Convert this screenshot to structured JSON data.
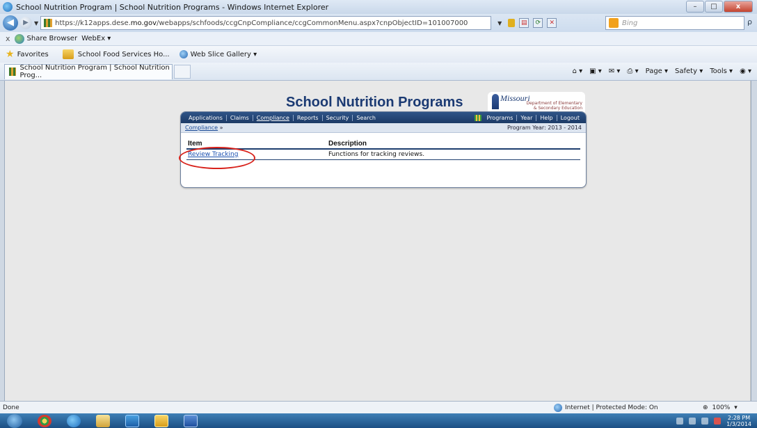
{
  "window": {
    "title": "School Nutrition Program | School Nutrition Programs - Windows Internet Explorer",
    "minimize_glyph": "–",
    "maximize_glyph": "□",
    "close_glyph": "x"
  },
  "address": {
    "url_prefix": "https://k12apps.dese.",
    "url_domain": "mo.gov",
    "url_path": "/webapps/schfoods/ccgCnpCompliance/ccgCommonMenu.aspx?cnpObjectID=101007000",
    "search_placeholder": "Bing",
    "search_go": "ρ"
  },
  "toolbar": {
    "close_glyph": "x",
    "share_browser": "Share Browser",
    "webex": "WebEx ▾"
  },
  "favorites": {
    "label": "Favorites",
    "items": [
      "School Food Services Ho...",
      "Web Slice Gallery ▾"
    ]
  },
  "tab": {
    "label": "School Nutrition Program | School Nutrition Prog..."
  },
  "command_bar": {
    "page": "Page ▾",
    "safety": "Safety ▾",
    "tools": "Tools ▾"
  },
  "site": {
    "title": "School Nutrition Programs",
    "logo_word": "Missouri",
    "logo_sub_1": "Department of Elementary",
    "logo_sub_2": "& Secondary Education",
    "menu": [
      "Applications",
      "Claims",
      "Compliance",
      "Reports",
      "Security",
      "Search"
    ],
    "menu_right": [
      "Programs",
      "Year",
      "Help",
      "Logout"
    ],
    "breadcrumb": "Compliance",
    "breadcrumb_sep": "»",
    "program_year": "Program Year: 2013 - 2014",
    "table": {
      "headers": [
        "Item",
        "Description"
      ],
      "rows": [
        {
          "item": "Review Tracking",
          "description": "Functions for tracking reviews."
        }
      ]
    },
    "annotation_color": "#d8221b"
  },
  "status": {
    "left": "Done",
    "zone": "Internet | Protected Mode: On",
    "zoom": "100%",
    "zoom_dropdown": "▾"
  },
  "taskbar": {
    "time": "2:28 PM",
    "date": "1/3/2014"
  }
}
